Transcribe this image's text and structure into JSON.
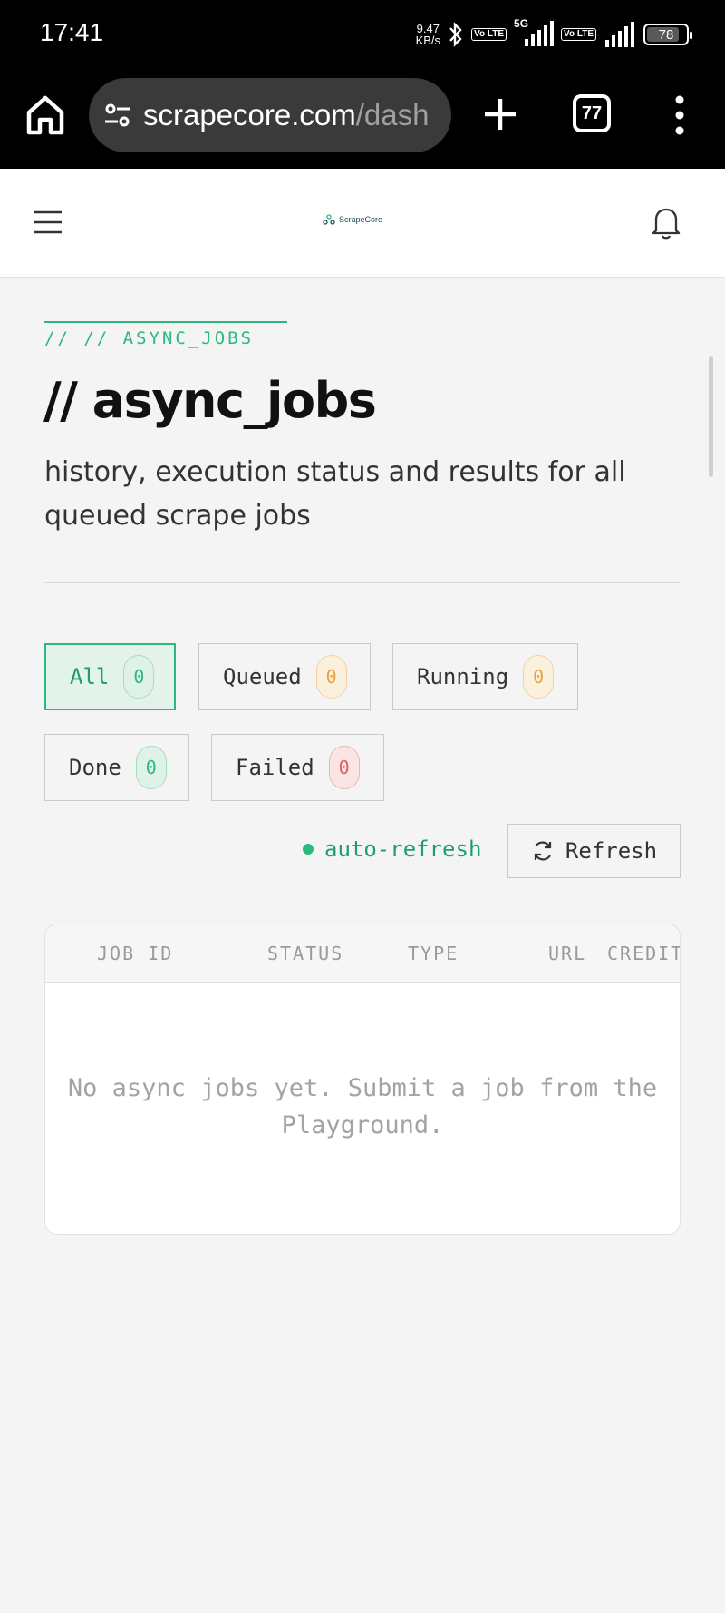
{
  "status_bar": {
    "time": "17:41",
    "net_speed_value": "9.47",
    "net_speed_unit": "KB/s",
    "volte_1": "Vo LTE",
    "network": "5G",
    "volte_2": "Vo LTE",
    "battery": "78"
  },
  "browser": {
    "url_host": "scrapecore.com",
    "url_path": "/dash",
    "tab_count": "77"
  },
  "app_header": {
    "logo_text": "ScrapeCore"
  },
  "page": {
    "eyebrow": "// // ASYNC_JOBS",
    "title": "// async_jobs",
    "subtitle": "history, execution status and results for all queued scrape jobs"
  },
  "filters": [
    {
      "label": "All",
      "count": "0",
      "color": "#2db87e"
    },
    {
      "label": "Queued",
      "count": "0",
      "color": "#e5a43b"
    },
    {
      "label": "Running",
      "count": "0",
      "color": "#e5a43b"
    },
    {
      "label": "Done",
      "count": "0",
      "color": "#2db87e"
    },
    {
      "label": "Failed",
      "count": "0",
      "color": "#d9625f"
    }
  ],
  "refresh": {
    "auto_label": "auto-refresh",
    "button_label": "Refresh"
  },
  "table": {
    "columns": [
      "JOB ID",
      "STATUS",
      "TYPE",
      "URL",
      "CREDIT"
    ],
    "empty_message": "No async jobs yet. Submit a job from the Playground."
  },
  "colors": {
    "accent": "#2db87e",
    "warning": "#e5a43b",
    "danger": "#d9625f"
  },
  "icons": [
    "home-icon",
    "site-settings-icon",
    "plus-icon",
    "tabs-icon",
    "more-vert-icon",
    "hamburger-icon",
    "bell-icon",
    "refresh-icon",
    "bluetooth-icon",
    "signal-icon",
    "battery-icon"
  ]
}
